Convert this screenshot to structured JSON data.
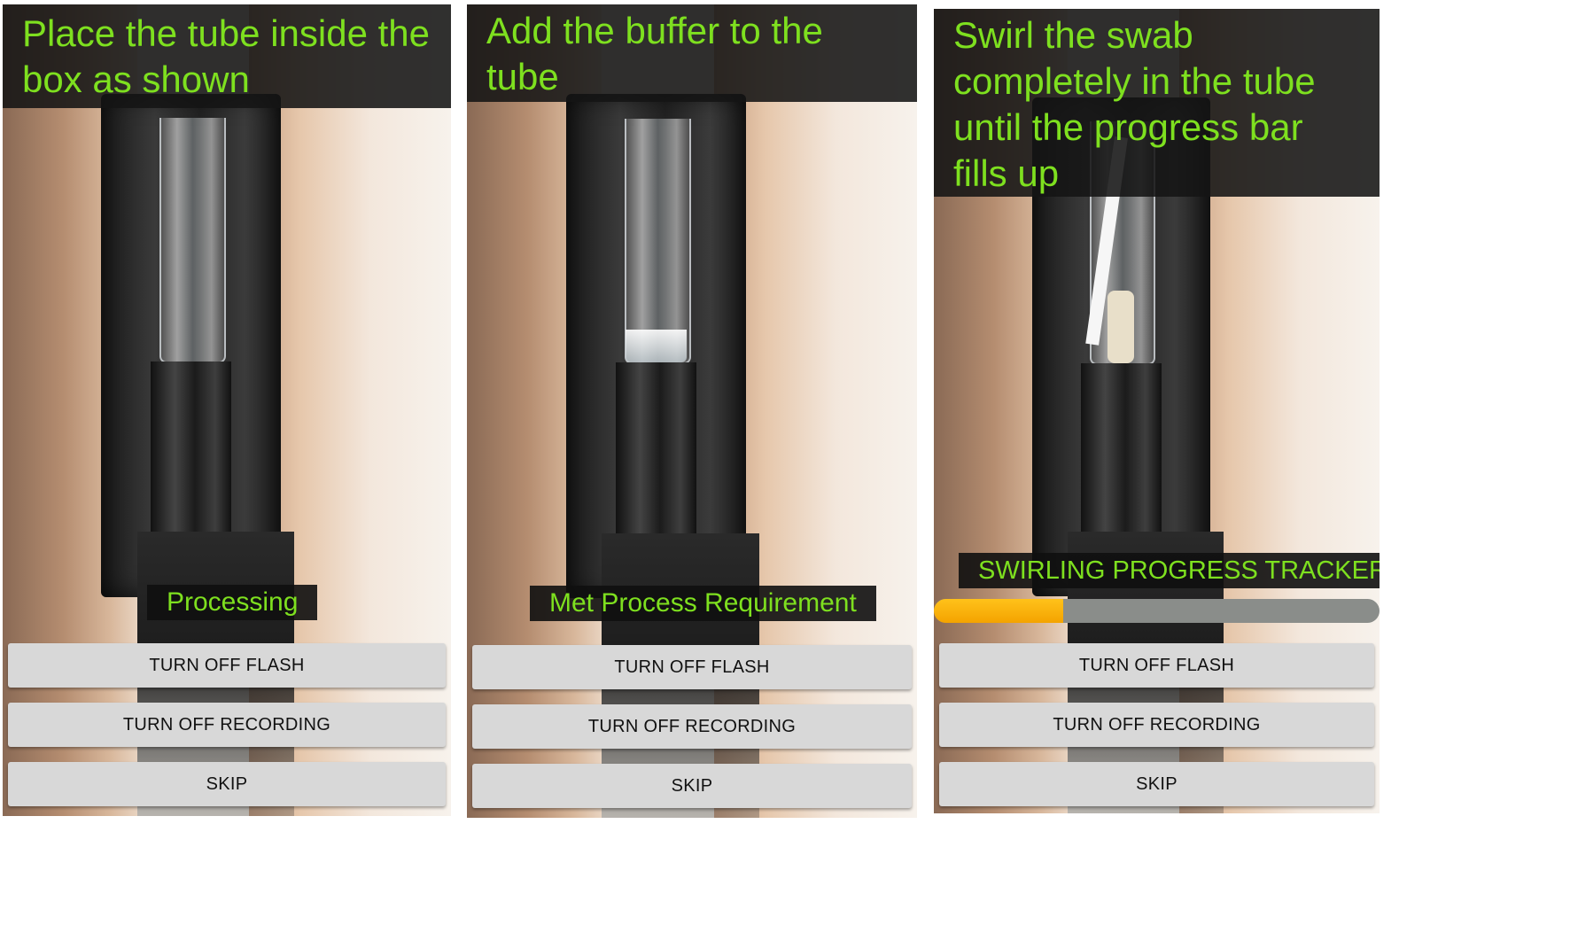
{
  "screens": [
    {
      "header": "Place the tube inside the box as shown",
      "status": "Processing",
      "buttons": {
        "flash": "TURN OFF FLASH",
        "recording": "TURN OFF RECORDING",
        "skip": "SKIP"
      }
    },
    {
      "header": "Add the buffer to the tube",
      "status": "Met Process Requirement",
      "buttons": {
        "flash": "TURN OFF FLASH",
        "recording": "TURN OFF RECORDING",
        "skip": "SKIP"
      }
    },
    {
      "header": "Swirl the swab completely in the tube until the progress bar fills up",
      "tracker_label": "SWIRLING PROGRESS TRACKER",
      "progress_fraction": 0.29,
      "buttons": {
        "flash": "TURN OFF FLASH",
        "recording": "TURN OFF RECORDING",
        "skip": "SKIP"
      }
    }
  ],
  "colors": {
    "instruction_text": "#7ee01f",
    "overlay_bg": "#141414",
    "button_bg": "#d8d8d8",
    "progress_fill": "#f4a300",
    "progress_track": "#8a8d8a"
  }
}
